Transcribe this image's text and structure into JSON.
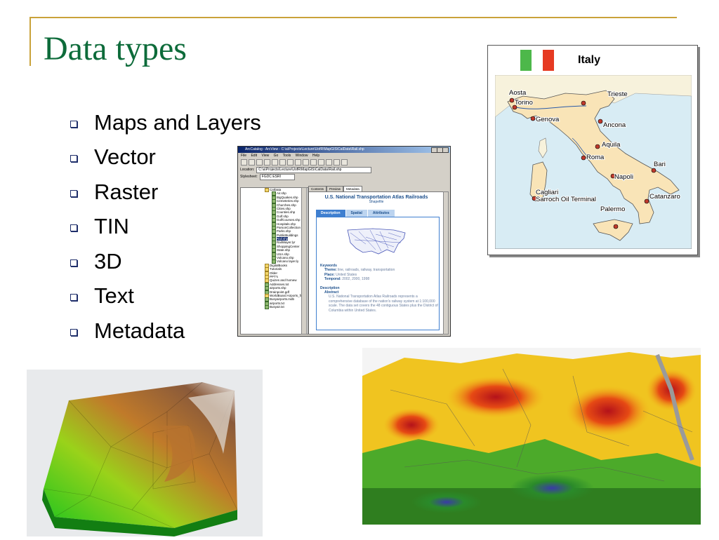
{
  "slide": {
    "title": "Data types",
    "bullets": [
      "Maps and Layers",
      "Vector",
      "Raster",
      "TIN",
      "3D",
      "Text",
      "Metadata"
    ]
  },
  "italy_map": {
    "title": "Italy",
    "cities": [
      "Aosta",
      "Torino",
      "Trieste",
      "Genova",
      "Ancona",
      "Aquila",
      "Roma",
      "Bari",
      "Napoli",
      "Cagliari",
      "Sarroch Oil Terminal",
      "Catanzaro",
      "Palermo"
    ]
  },
  "arccatalog": {
    "window_title": "ArcCatalog - ArcView - C:\\a\\Projects\\Lecture\\UofR\\MapGIS\\CalData\\Rail.shp",
    "menu": [
      "File",
      "Edit",
      "View",
      "Go",
      "Tools",
      "Window",
      "Help"
    ],
    "location_label": "Location:",
    "location_value": "C:\\a\\Projects\\Lecture\\UofR\\MapGIS\\CalData\\Rail.shp",
    "stylesheet_label": "Stylesheet:",
    "stylesheet_value": "FGDC ESRI",
    "tree": [
      "CalData",
      "Air.shp",
      "BigQuakes.shp",
      "Cemeteries.shp",
      "Churches.shp",
      "Cities.shp",
      "Counties.shp",
      "Golf.shp",
      "GolfCourses.shp",
      "Hospitals.shp",
      "ParsonCollection",
      "Parks.shp",
      "PublicBuildings",
      "Rail.shp",
      "RailWayer.lyr",
      "ShoppingCenter",
      "State.shp",
      "USA.shp",
      "Volcano.shp",
      "Volcano layer.ly",
      "DigitalBooks",
      "Tutorials",
      "Older",
      "PPT's",
      "Quizes and homew",
      "Addresses.txt",
      "airports.shp",
      "Drainpoint.gdf",
      "WorldBoard Airports_files",
      "Busyairports.mdb",
      "airports.txt",
      "Busyair.txt"
    ],
    "tabs": [
      "Contents",
      "Preview",
      "Metadata"
    ],
    "meta_title": "U.S. National Transportation Atlas Railroads",
    "meta_subtitle": "Shapefile",
    "meta_tabs": [
      "Description",
      "Spatial",
      "Attributes"
    ],
    "keywords_heading": "Keywords",
    "theme_label": "Theme:",
    "theme_value": "line, railroads, railway, transportation",
    "place_label": "Place:",
    "place_value": "United States",
    "temporal_label": "Temporal:",
    "temporal_value": "2002, 2000, 1998",
    "description_heading": "Description",
    "abstract_heading": "Abstract",
    "abstract_text": "U.S. National Transportation Atlas Railroads represents a comprehensive database of the nation's railway system at 1:100,000 scale. The data set covers the 48 contiguous States plus the District of Columbia within United States."
  },
  "colors": {
    "title": "#0d6b3a",
    "rule": "#c9a23a",
    "bullet": "#1e2e6a",
    "sea": "#d8ecf4",
    "land": "#f9e4b7",
    "city": "#c0392b"
  }
}
